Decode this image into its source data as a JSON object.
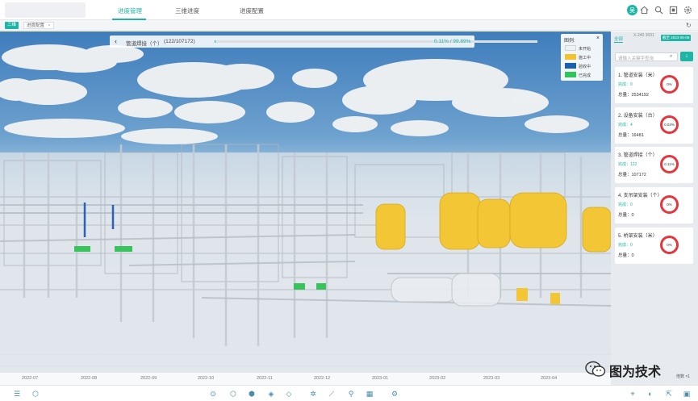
{
  "header": {
    "tabs": [
      {
        "label": "进度管理",
        "active": true
      },
      {
        "label": "三维进度",
        "active": false
      },
      {
        "label": "进度配置",
        "active": false
      }
    ],
    "user_initial": "吴",
    "accent_color": "#1fb5a5"
  },
  "tabbar": {
    "view_tag": "三维",
    "page_tab": "进度配置",
    "close_glyph": "×"
  },
  "progress": {
    "title": "管道焊接（个）",
    "count": "(122/107172)",
    "percent_text": "0.11% / 99.89%",
    "fraction": 0.0011
  },
  "legend": {
    "title": "图例:",
    "close_glyph": "×",
    "items": [
      {
        "label": "未开始",
        "color": "#eef0f2"
      },
      {
        "label": "施工中",
        "color": "#f2c230"
      },
      {
        "label": "验收中",
        "color": "#1b5fb0"
      },
      {
        "label": "已完成",
        "color": "#2fc659"
      }
    ]
  },
  "side": {
    "tab_all": "全部",
    "tab_date": "X-240 3031",
    "badge": "截至 2023-05-06",
    "search_placeholder": "请输入关键字查询",
    "cards": [
      {
        "title": "1. 管道安装（米）",
        "done": "完成：0",
        "total": "总量：2534192",
        "pct": "0%"
      },
      {
        "title": "2. 设备安装（台）",
        "done": "完成：4",
        "total": "总量：16481",
        "pct": "0.03%"
      },
      {
        "title": "3. 管道焊接（个）",
        "done": "完成：122",
        "total": "总量：107172",
        "pct": "0.11%"
      },
      {
        "title": "4. 支吊架安装（个）",
        "done": "完成：0",
        "total": "总量：0",
        "pct": "0%"
      },
      {
        "title": "5. 桥架安装（米）",
        "done": "完成：0",
        "total": "总量：0",
        "pct": "0%"
      }
    ]
  },
  "timeline": {
    "months": [
      "2022-07",
      "2022-08",
      "2022-09",
      "2022-10",
      "2022-11",
      "2022-12",
      "2023-01",
      "2023-02",
      "2023-03",
      "2023-04"
    ],
    "speed": "倍数 ×1"
  },
  "watermark": {
    "text": "图为技术"
  }
}
